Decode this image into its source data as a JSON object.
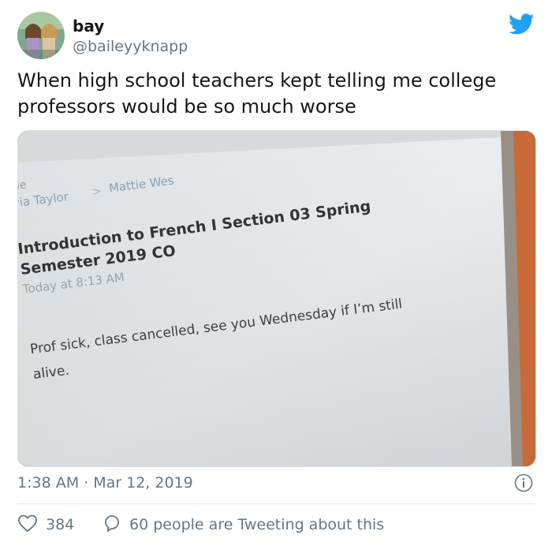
{
  "author": {
    "name": "bay",
    "handle": "@baileyyknapp"
  },
  "tweet": {
    "text": "When high school teachers kept telling me college professors would be so much worse"
  },
  "photo": {
    "breadcrumb": {
      "top_fragment": "Colle",
      "parent": "llivia Taylor",
      "separator": ">",
      "current": "Mattie Wes"
    },
    "email_subject_line1": "Introduction to French I Section 03 Spring",
    "email_subject_line2": "Semester 2019 CO",
    "email_time": "Today at 8:13 AM",
    "email_body_line1": "Prof sick, class cancelled, see you Wednesday if I’m still",
    "email_body_line2": "alive."
  },
  "meta": {
    "timestamp": "1:38 AM · Mar 12, 2019"
  },
  "stats": {
    "likes": "384",
    "discussion": "60 people are Tweeting about this"
  },
  "colors": {
    "brand": "#1da1f2",
    "muted": "#657786"
  },
  "icons": {
    "bird": "twitter-bird-icon",
    "info": "info-icon",
    "like": "heart-icon",
    "reply": "speech-bubble-icon"
  }
}
